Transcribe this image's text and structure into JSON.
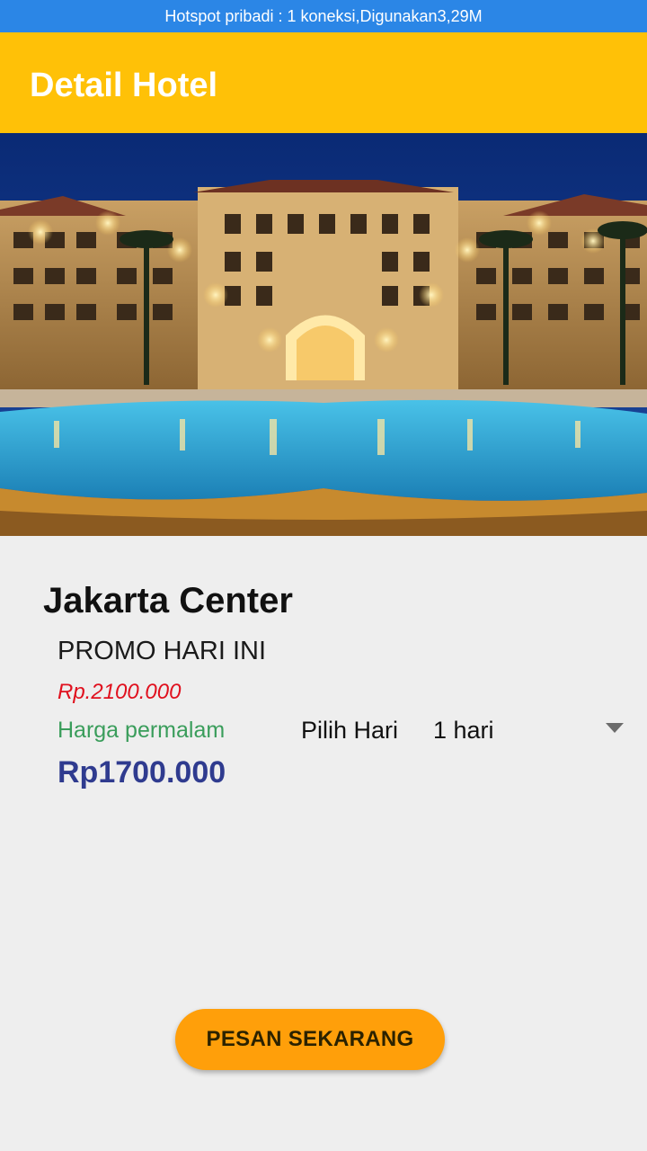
{
  "status_bar": {
    "text": "Hotspot pribadi : 1 koneksi,Digunakan3,29M"
  },
  "app_bar": {
    "title": "Detail Hotel"
  },
  "hero_image": {
    "subject": "hotel-with-pool-at-night"
  },
  "hotel": {
    "name": "Jakarta Center",
    "promo_label": "PROMO HARI INI",
    "original_price": "Rp.2100.000",
    "per_night_label": "Harga permalam",
    "discount_price": "Rp1700.000"
  },
  "day_picker": {
    "label": "Pilih Hari",
    "selected": "1 hari",
    "arrow_icon": "dropdown-arrow-icon"
  },
  "actions": {
    "order_label": "PESAN SEKARANG"
  },
  "colors": {
    "status_bar": "#2b86e6",
    "app_bar": "#ffc107",
    "old_price": "#e0101e",
    "per_night": "#3a9d5b",
    "new_price": "#2f3b8f",
    "button": "#ff9f0a"
  }
}
